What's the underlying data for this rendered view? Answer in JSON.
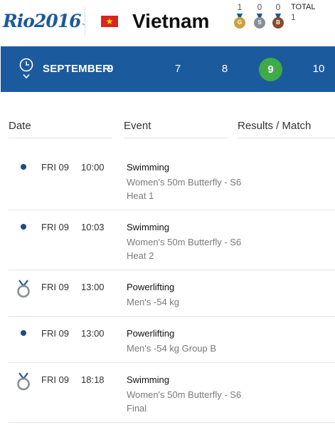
{
  "header": {
    "logo_text": "Rio2016",
    "country_name": "Vietnam",
    "flag_icon": "vietnam-flag-icon",
    "medals": {
      "gold": {
        "count": "1",
        "letter": "G"
      },
      "silver": {
        "count": "0",
        "letter": "S"
      },
      "bronze": {
        "count": "0",
        "letter": "B"
      },
      "total_label": "TOTAL",
      "total_value": "1"
    }
  },
  "datebar": {
    "month": "SEPTEMBER",
    "month_day": "9",
    "days": [
      "7",
      "8",
      "9",
      "10"
    ],
    "selected_day": "9",
    "selected_color": "#3eaa48",
    "bar_color": "#1c5a9e"
  },
  "table": {
    "columns": [
      "Date",
      "Event",
      "Results / Match"
    ],
    "rows": [
      {
        "icon": "dot-icon",
        "day": "FRI 09",
        "time": "10:00",
        "sport": "Swimming",
        "event": "Women's 50m Butterfly - S6 Heat 1"
      },
      {
        "icon": "dot-icon",
        "day": "FRI 09",
        "time": "10:03",
        "sport": "Swimming",
        "event": "Women's 50m Butterfly - S6 Heat 2"
      },
      {
        "icon": "medal-icon",
        "day": "FRI 09",
        "time": "13:00",
        "sport": "Powerlifting",
        "event": "Men's -54 kg"
      },
      {
        "icon": "dot-icon",
        "day": "FRI 09",
        "time": "13:00",
        "sport": "Powerlifting",
        "event": "Men's -54 kg Group B"
      },
      {
        "icon": "medal-icon",
        "day": "FRI 09",
        "time": "18:18",
        "sport": "Swimming",
        "event": "Women's 50m Butterfly - S6 Final"
      }
    ]
  }
}
